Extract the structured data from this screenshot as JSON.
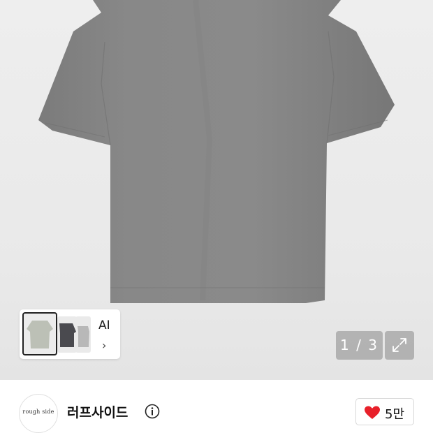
{
  "gallery": {
    "thumbnail_label": "AI",
    "thumbnail_chevron": "›",
    "counter": "1 / 3",
    "expand_icon": "expand-arrows-icon"
  },
  "brand": {
    "logo_text": "rough side",
    "name": "러프사이드",
    "info_icon": "info-circle-icon"
  },
  "like": {
    "icon": "heart-icon",
    "count": "5만",
    "color": "#e8202a"
  }
}
